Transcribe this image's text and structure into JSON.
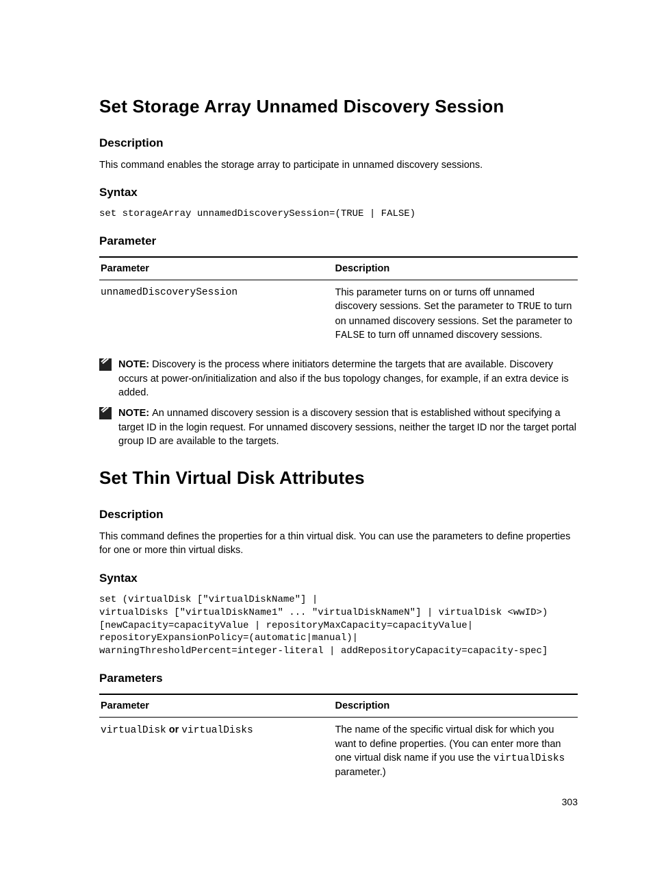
{
  "section1": {
    "title": "Set Storage Array Unnamed Discovery Session",
    "descHeading": "Description",
    "descText": "This command enables the storage array to participate in unnamed discovery sessions.",
    "syntaxHeading": "Syntax",
    "syntaxCode": "set storageArray unnamedDiscoverySession=(TRUE | FALSE)",
    "paramHeading": "Parameter",
    "table": {
      "hParam": "Parameter",
      "hDesc": "Description",
      "row1": {
        "param": "unnamedDiscoverySession",
        "desc_a": "This parameter turns on or turns off unnamed discovery sessions. Set the parameter to ",
        "desc_true": "TRUE",
        "desc_b": " to turn on unnamed discovery sessions. Set the parameter to ",
        "desc_false": "FALSE",
        "desc_c": " to turn off unnamed discovery sessions."
      }
    },
    "note1": {
      "label": "NOTE: ",
      "text": "Discovery is the process where initiators determine the targets that are available. Discovery occurs at power-on/initialization and also if the bus topology changes, for example, if an extra device is added."
    },
    "note2": {
      "label": "NOTE: ",
      "text": "An unnamed discovery session is a discovery session that is established without specifying a target ID in the login request. For unnamed discovery sessions, neither the target ID nor the target portal group ID are available to the targets."
    }
  },
  "section2": {
    "title": "Set Thin Virtual Disk Attributes",
    "descHeading": "Description",
    "descText": "This command defines the properties for a thin virtual disk. You can use the parameters to define properties for one or more thin virtual disks.",
    "syntaxHeading": "Syntax",
    "syntaxCode": "set (virtualDisk [\"virtualDiskName\"] |\nvirtualDisks [\"virtualDiskName1\" ... \"virtualDiskNameN\"] | virtualDisk <wwID>)\n[newCapacity=capacityValue | repositoryMaxCapacity=capacityValue|\nrepositoryExpansionPolicy=(automatic|manual)|\nwarningThresholdPercent=integer-literal | addRepositoryCapacity=capacity-spec]",
    "paramHeading": "Parameters",
    "table": {
      "hParam": "Parameter",
      "hDesc": "Description",
      "row1": {
        "p1": "virtualDisk",
        "or": " or ",
        "p2": "virtualDisks",
        "desc_a": "The name of the specific virtual disk for which you want to define properties. (You can enter more than one virtual disk name if you use the ",
        "desc_code": "virtualDisks",
        "desc_b": " parameter.)"
      }
    }
  },
  "pageNumber": "303"
}
